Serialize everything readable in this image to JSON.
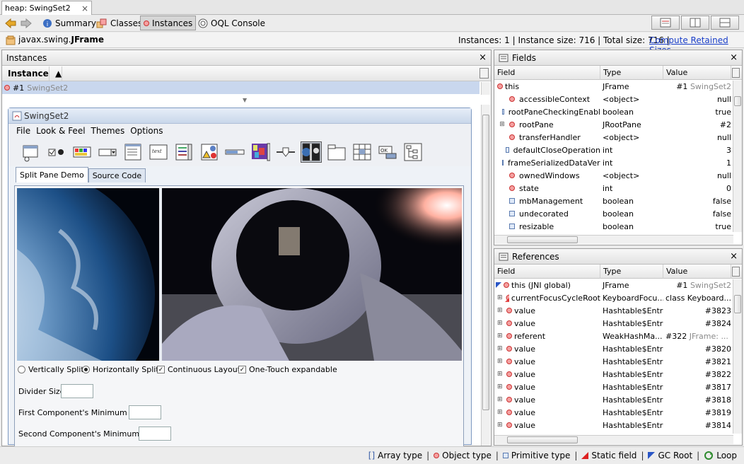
{
  "tab": {
    "title": "heap: SwingSet2",
    "close": "×"
  },
  "toolbar": {
    "summary": "Summary",
    "classes": "Classes",
    "instances": "Instances",
    "oql": "OQL Console"
  },
  "info": {
    "class_prefix": "javax.swing.",
    "class_name": "JFrame",
    "stats": "Instances: 1  |  Instance size: 716  |  Total size: 716  |",
    "compute_link": "Compute Retained Sizes"
  },
  "instances_panel": {
    "title": "Instances",
    "close": "×",
    "header": "Instance",
    "row_id": "#1",
    "row_name": "SwingSet2"
  },
  "swing": {
    "title": "SwingSet2",
    "menu": [
      "File",
      "Look & Feel",
      "Themes",
      "Options"
    ],
    "tabs": [
      "Split Pane Demo",
      "Source Code"
    ],
    "orientation": {
      "vertical": "Vertically Split",
      "horizontal": "Horizontally Split"
    },
    "checks": {
      "continuous": "Continuous Layout",
      "onetouch": "One-Touch expandable"
    },
    "labels": {
      "divider": "Divider Size",
      "first": "First Component's Minimum Size",
      "second": "Second Component's Minimum Size"
    }
  },
  "fields_panel": {
    "title": "Fields",
    "close": "×",
    "headers": [
      "Field",
      "Type",
      "Value"
    ],
    "this": {
      "name": "this",
      "type": "JFrame",
      "value_id": "#1",
      "value_name": "SwingSet2"
    },
    "rows": [
      {
        "kind": "object",
        "expand": false,
        "name": "accessibleContext",
        "type": "<object>",
        "value": "null"
      },
      {
        "kind": "primitive",
        "expand": false,
        "name": "rootPaneCheckingEnabl",
        "type": "boolean",
        "value": "true"
      },
      {
        "kind": "object",
        "expand": true,
        "name": "rootPane",
        "type": "JRootPane",
        "value": "#2"
      },
      {
        "kind": "object",
        "expand": false,
        "name": "transferHandler",
        "type": "<object>",
        "value": "null"
      },
      {
        "kind": "primitive",
        "expand": false,
        "name": "defaultCloseOperation",
        "type": "int",
        "value": "3"
      },
      {
        "kind": "primitive",
        "expand": false,
        "name": "frameSerializedDataVers",
        "type": "int",
        "value": "1"
      },
      {
        "kind": "object",
        "expand": false,
        "name": "ownedWindows",
        "type": "<object>",
        "value": "null"
      },
      {
        "kind": "object",
        "expand": false,
        "name": "state",
        "type": "int",
        "value": "0"
      },
      {
        "kind": "primitive",
        "expand": false,
        "name": "mbManagement",
        "type": "boolean",
        "value": "false"
      },
      {
        "kind": "primitive",
        "expand": false,
        "name": "undecorated",
        "type": "boolean",
        "value": "false"
      },
      {
        "kind": "primitive",
        "expand": false,
        "name": "resizable",
        "type": "boolean",
        "value": "true"
      }
    ]
  },
  "refs_panel": {
    "title": "References",
    "close": "×",
    "headers": [
      "Field",
      "Type",
      "Value"
    ],
    "this": {
      "name": "this (JNI global)",
      "type": "JFrame",
      "value_id": "#1",
      "value_name": "SwingSet2"
    },
    "rows": [
      {
        "name": "currentFocusCycleRoot",
        "type": "KeyboardFocu...",
        "value": "class Keyboard...",
        "special": true
      },
      {
        "name": "value",
        "type": "Hashtable$Entry",
        "value": "#3823"
      },
      {
        "name": "value",
        "type": "Hashtable$Entry",
        "value": "#3824"
      },
      {
        "name": "referent",
        "type": "WeakHashMa...",
        "value": "#322",
        "value_gray": "JFrame: ..."
      },
      {
        "name": "value",
        "type": "Hashtable$Entry",
        "value": "#3820"
      },
      {
        "name": "value",
        "type": "Hashtable$Entry",
        "value": "#3821"
      },
      {
        "name": "value",
        "type": "Hashtable$Entry",
        "value": "#3822"
      },
      {
        "name": "value",
        "type": "Hashtable$Entry",
        "value": "#3817"
      },
      {
        "name": "value",
        "type": "Hashtable$Entry",
        "value": "#3818"
      },
      {
        "name": "value",
        "type": "Hashtable$Entry",
        "value": "#3819"
      },
      {
        "name": "value",
        "type": "Hashtable$Entry",
        "value": "#3814"
      }
    ]
  },
  "status": {
    "array": "Array type",
    "object": "Object type",
    "primitive": "Primitive type",
    "static": "Static field",
    "gc": "GC Root",
    "loop": "Loop",
    "sep": "|"
  }
}
